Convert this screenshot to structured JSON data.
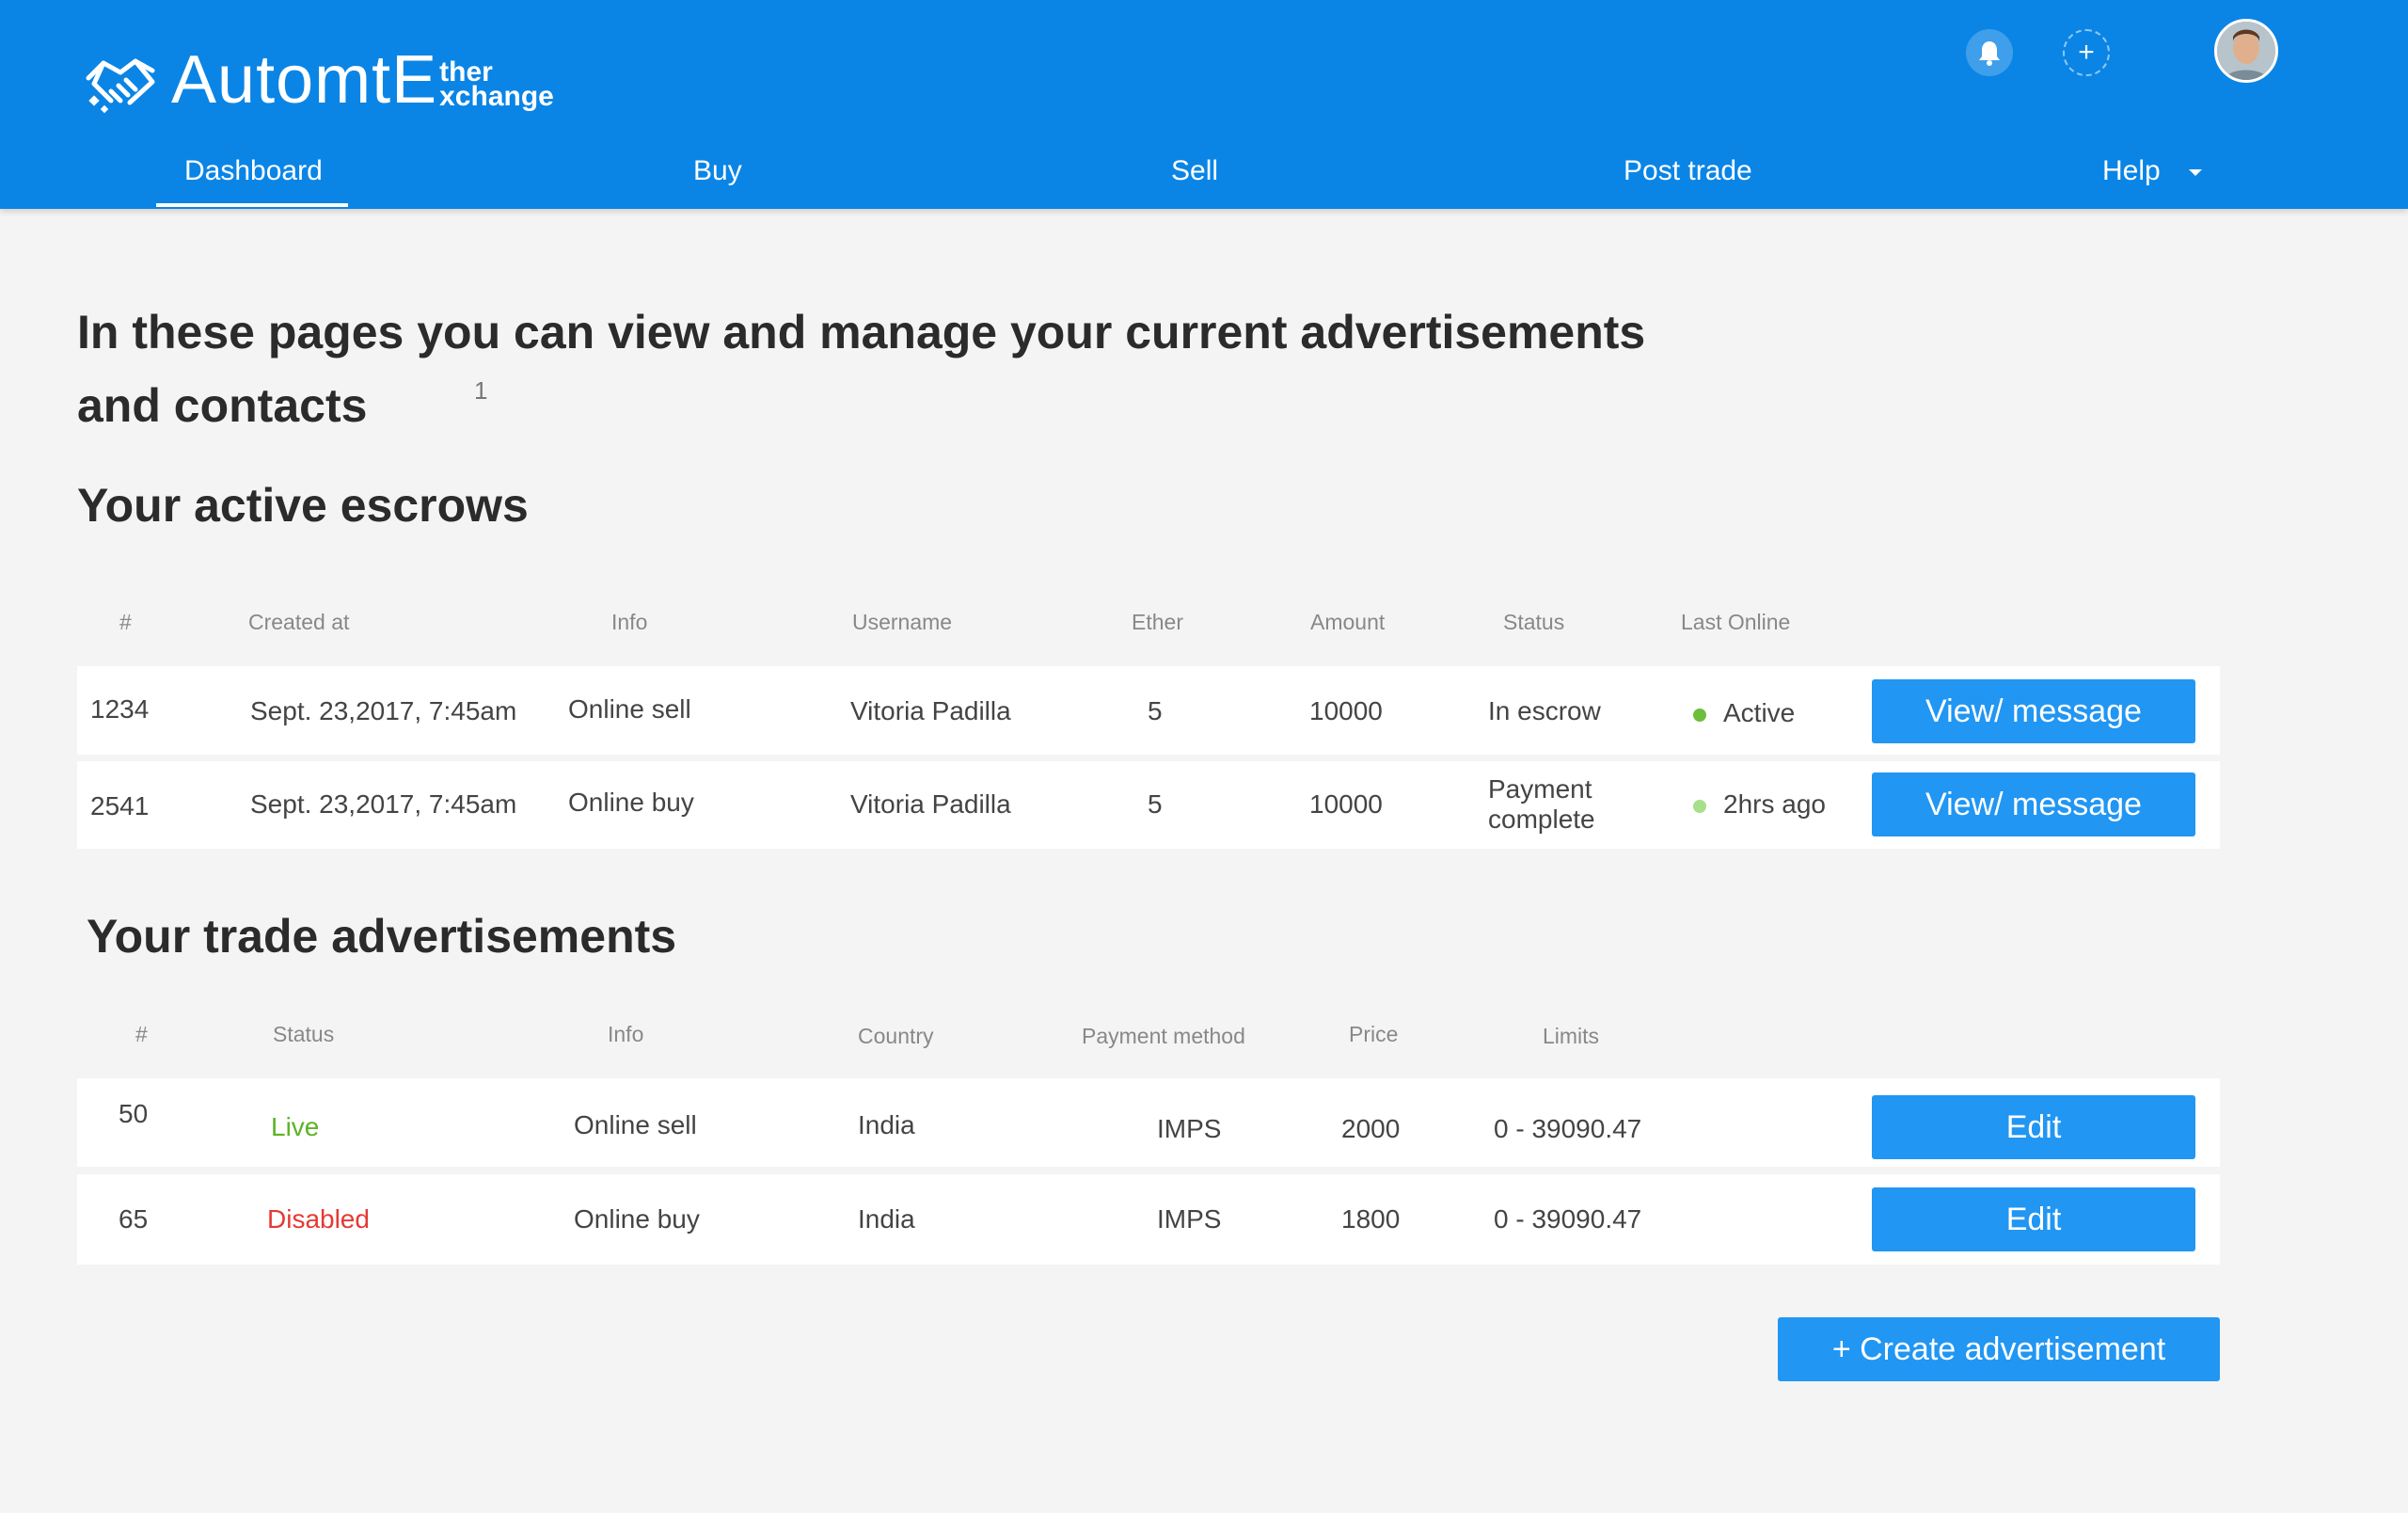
{
  "brand": {
    "name_main": "AutomtE",
    "name_top": "ther",
    "name_bottom": "xchange"
  },
  "header": {
    "icons": [
      "bell-icon",
      "plus-icon",
      "avatar"
    ]
  },
  "nav": {
    "items": [
      "Dashboard",
      "Buy",
      "Sell",
      "Post trade",
      "Help"
    ],
    "active": "Dashboard"
  },
  "intro": {
    "line1": "In these pages you can view and manage your current advertisements",
    "line2": "and contacts",
    "badge": "1"
  },
  "escrows": {
    "title": "Your active escrows",
    "columns": [
      "#",
      "Created at",
      "Info",
      "Username",
      "Ether",
      "Amount",
      "Status",
      "Last Online"
    ],
    "rows": [
      {
        "id": "1234",
        "created": "Sept. 23,2017, 7:45am",
        "info": "Online sell",
        "username": "Vitoria Padilla",
        "ether": "5",
        "amount": "10000",
        "status": "In escrow",
        "last_online": "Active",
        "action": "View/ message"
      },
      {
        "id": "2541",
        "created": "Sept. 23,2017, 7:45am",
        "info": "Online buy",
        "username": "Vitoria Padilla",
        "ether": "5",
        "amount": "10000",
        "status": "Payment complete",
        "last_online": "2hrs ago",
        "action": "View/ message"
      }
    ]
  },
  "ads": {
    "title": "Your trade advertisements",
    "columns": [
      "#",
      "Status",
      "Info",
      "Country",
      "Payment method",
      "Price",
      "Limits"
    ],
    "rows": [
      {
        "id": "50",
        "status": "Live",
        "info": "Online sell",
        "country": "India",
        "payment": "IMPS",
        "price": "2000",
        "limits": "0 - 39090.47",
        "action": "Edit"
      },
      {
        "id": "65",
        "status": "Disabled",
        "info": "Online buy",
        "country": "India",
        "payment": "IMPS",
        "price": "1800",
        "limits": "0 - 39090.47",
        "action": "Edit"
      }
    ],
    "create_button": "+ Create advertisement"
  },
  "colors": {
    "header": "#0a85e6",
    "button": "#2196f3",
    "live": "#5db327",
    "disabled": "#e53935",
    "online_active": "#6cbf3a",
    "online_recent": "#a6e08a"
  }
}
